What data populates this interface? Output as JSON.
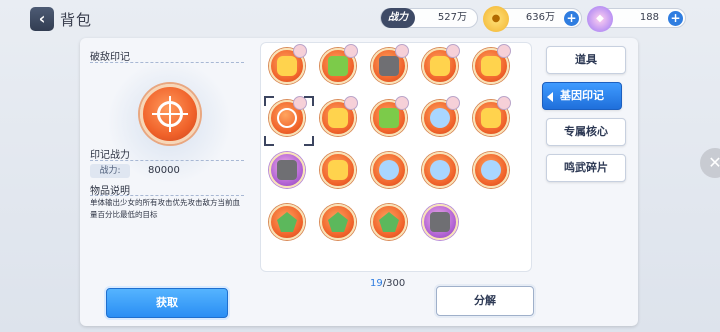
{
  "header": {
    "title": "背包",
    "back_icon": "back-arrow-icon",
    "power_label": "战力",
    "power_value": "527万",
    "gold_value": "636万",
    "gem_value": "188"
  },
  "detail": {
    "name": "破敌印记",
    "power_title": "印记战力",
    "power_chip": "战力:",
    "power_value": "80000",
    "desc_title": "物品说明",
    "description": "单体输出少女的所有攻击优先攻击敌方当前血量百分比最低的目标"
  },
  "grid": {
    "count_current": "19",
    "count_total": "/300",
    "selected_index": 5,
    "items": [
      {
        "name": "seal-orange-1",
        "style": "orange",
        "glyph": "g-yellow",
        "chibi": true
      },
      {
        "name": "seal-orange-2",
        "style": "orange",
        "glyph": "g-green",
        "chibi": true
      },
      {
        "name": "seal-orange-3",
        "style": "orange",
        "glyph": "g-gray",
        "chibi": true
      },
      {
        "name": "seal-orange-4",
        "style": "orange",
        "glyph": "g-yellow",
        "chibi": true
      },
      {
        "name": "seal-orange-5",
        "style": "orange",
        "glyph": "g-yellow",
        "chibi": true
      },
      {
        "name": "seal-target",
        "style": "orange",
        "glyph": "g-target",
        "chibi": true
      },
      {
        "name": "seal-orange-7",
        "style": "orange",
        "glyph": "g-yellow",
        "chibi": true
      },
      {
        "name": "seal-orange-8",
        "style": "orange",
        "glyph": "g-green",
        "chibi": true
      },
      {
        "name": "seal-orange-9",
        "style": "orange",
        "glyph": "g-blue",
        "chibi": true
      },
      {
        "name": "seal-orange-10",
        "style": "orange",
        "glyph": "g-yellow",
        "chibi": true
      },
      {
        "name": "seal-purple-1",
        "style": "purple",
        "glyph": "g-gray",
        "chibi": false
      },
      {
        "name": "seal-orange-12",
        "style": "orange",
        "glyph": "g-yellow",
        "chibi": false
      },
      {
        "name": "seal-orange-13",
        "style": "orange",
        "glyph": "g-blue",
        "chibi": false
      },
      {
        "name": "seal-orange-14",
        "style": "orange",
        "glyph": "g-blue",
        "chibi": false
      },
      {
        "name": "seal-orange-15",
        "style": "orange",
        "glyph": "g-blue",
        "chibi": false
      },
      {
        "name": "seal-orange-16",
        "style": "orange",
        "glyph": "g-green2",
        "chibi": false
      },
      {
        "name": "seal-orange-17",
        "style": "orange",
        "glyph": "g-green2",
        "chibi": false
      },
      {
        "name": "seal-orange-18",
        "style": "orange",
        "glyph": "g-green2",
        "chibi": false
      },
      {
        "name": "seal-purple-2",
        "style": "purple",
        "glyph": "g-gray",
        "chibi": false
      }
    ]
  },
  "tabs": [
    {
      "label": "道具",
      "active": false
    },
    {
      "label": "基因印记",
      "active": true
    },
    {
      "label": "专属核心",
      "active": false
    },
    {
      "label": "鸣武碎片",
      "active": false
    }
  ],
  "buttons": {
    "obtain": "获取",
    "decompose": "分解"
  },
  "colors": {
    "accent": "#2a8ef4",
    "seal_orange": "#f0622a",
    "seal_purple": "#b567d6"
  }
}
